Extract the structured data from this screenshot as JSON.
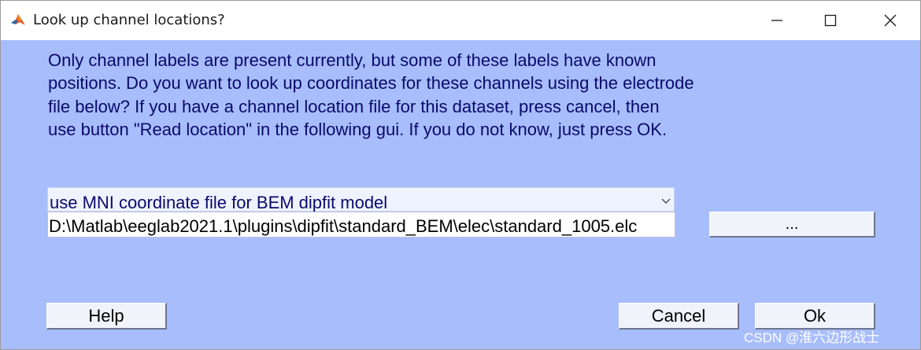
{
  "window": {
    "title": "Look up channel locations?",
    "app_icon": "matlab-icon",
    "controls": {
      "minimize": "minimize-icon",
      "maximize": "maximize-icon",
      "close": "close-icon"
    }
  },
  "dialog": {
    "message": "Only channel labels are present currently, but some of these labels have known\npositions. Do you want to look up coordinates for these channels using the electrode\nfile below? If you have a channel location file for this dataset, press cancel, then\nuse button \"Read location\" in the following gui. If you do not know, just press OK.",
    "coordinate_select": {
      "selected": "use MNI coordinate file for BEM dipfit model",
      "icon": "chevron-down-icon"
    },
    "electrode_file": {
      "value": "D:\\Matlab\\eeglab2021.1\\plugins\\dipfit\\standard_BEM\\elec\\standard_1005.elc"
    },
    "browse_label": "...",
    "help_label": "Help",
    "cancel_label": "Cancel",
    "ok_label": "Ok"
  },
  "watermark": "CSDN @淮六边形战士",
  "colors": {
    "dialog_background": "#a8bdfc",
    "text": "#0a0a6a",
    "titlebar": "#ffffff"
  }
}
